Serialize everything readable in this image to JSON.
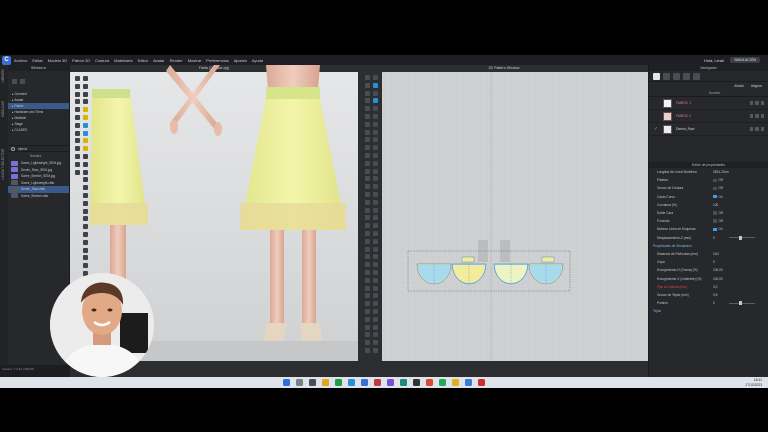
{
  "app": {
    "logo": "C",
    "menu": [
      "Archivo",
      "Editar",
      "Modelo 3D",
      "Patrón 2D",
      "Costura",
      "Materiales",
      "Editor",
      "Avatar",
      "Render",
      "Mostrar",
      "Preferencias",
      "Ajustes",
      "Ayuda"
    ],
    "user": "Hola, Lleah",
    "mode_button": "SIMULACIÓN"
  },
  "left_tabs": [
    "LIBRARY",
    "MODULAR",
    "LAYOUT SELECTOR"
  ],
  "library": {
    "title": "Biblioteca",
    "tree": [
      "Garment",
      "Avatar",
      "Fabric",
      "Hardware and Trims",
      "Material",
      "Stage",
      "CLASES"
    ],
    "tree_selected": 2,
    "search_label": "ejercic",
    "column_header": "Nombre",
    "files": [
      {
        "name": "Saree_Lightweight_SEM.jpg",
        "dark": false
      },
      {
        "name": "Denim_Raw_SEM.jpg",
        "dark": false
      },
      {
        "name": "Saree_Stretch_SEM.jpg",
        "dark": false
      },
      {
        "name": "Saree_Lightweight.zfab",
        "dark": true
      },
      {
        "name": "Denim_Raw.zfab",
        "dark": true
      },
      {
        "name": "Saree_Stretch.zfab",
        "dark": true
      }
    ],
    "file_selected": 4,
    "version": "Version: 7.2.94 (r48407)"
  },
  "viewport3d": {
    "title": "Falda (Circular.zpj)"
  },
  "pattern2d": {
    "title": "2D Pattern Window"
  },
  "colors": {
    "skirt_yellow": "#eef09a",
    "skirt_hem": "#e7d99a",
    "waistband": "#d7e58a",
    "skin": "#eec8b6",
    "pattern_blue": "#9fd4ee",
    "pattern_yellow": "#f3ec9a",
    "accent_blue": "#3aa0e8"
  },
  "navigator": {
    "title": "Navegador",
    "actions": [
      "Añadir",
      "Asignar"
    ],
    "column_header": "Nombre",
    "fabrics": [
      {
        "name": "FABRIC 1",
        "color": "#f3f3f3",
        "checked": false
      },
      {
        "name": "FABRIC 2",
        "color": "#f1cfc8",
        "checked": false
      },
      {
        "name": "Denim_Raw",
        "color": "#ececec",
        "checked": true
      }
    ]
  },
  "property_editor": {
    "title": "Editor de propiedades",
    "rows": [
      {
        "label": "Longitud de Línea Simétrica",
        "value": "3534.22cm",
        "type": "text"
      },
      {
        "label": "Plástico",
        "value": "Off",
        "type": "toggle",
        "on": false
      },
      {
        "label": "Grosor de Costura",
        "value": "Off",
        "type": "toggle",
        "on": false
      },
      {
        "label": "Canto Curvo",
        "value": "On",
        "type": "toggle",
        "on": true
      },
      {
        "label": "Curvatura (%)",
        "value": "100",
        "type": "text"
      },
      {
        "label": "Doble Cara",
        "value": "Off",
        "type": "toggle",
        "on": false
      },
      {
        "label": "Fruncido",
        "value": "Off",
        "type": "toggle",
        "on": false
      },
      {
        "label": "Mostrar Línea de Esquema",
        "value": "On",
        "type": "toggle",
        "on": true
      },
      {
        "label": "Desplazamiento-Z (mm)",
        "value": "0",
        "type": "slider"
      },
      {
        "label": "Propiedades de Simulación",
        "value": "",
        "type": "section"
      },
      {
        "label": "Distancia de Partículas (mm)",
        "value": "15,0",
        "type": "text"
      },
      {
        "label": "Capa",
        "value": "0",
        "type": "text"
      },
      {
        "label": "Encogimiento-H (Trama) (%)",
        "value": "100,00",
        "type": "text"
      },
      {
        "label": "Encogimiento-V (Urdimbre) (%)",
        "value": "100,00",
        "type": "text"
      },
      {
        "label": "Fijar la Costura (mm)",
        "value": "3,0",
        "type": "text",
        "warn": true
      },
      {
        "label": "Grosor de Tejido (mm)",
        "value": "0,5",
        "type": "text"
      },
      {
        "label": "Presión",
        "value": "0",
        "type": "slider"
      },
      {
        "label": "Tejido",
        "value": "",
        "type": "section"
      }
    ]
  },
  "taskbar": {
    "time": "18:41",
    "date": "27/12/2023"
  }
}
